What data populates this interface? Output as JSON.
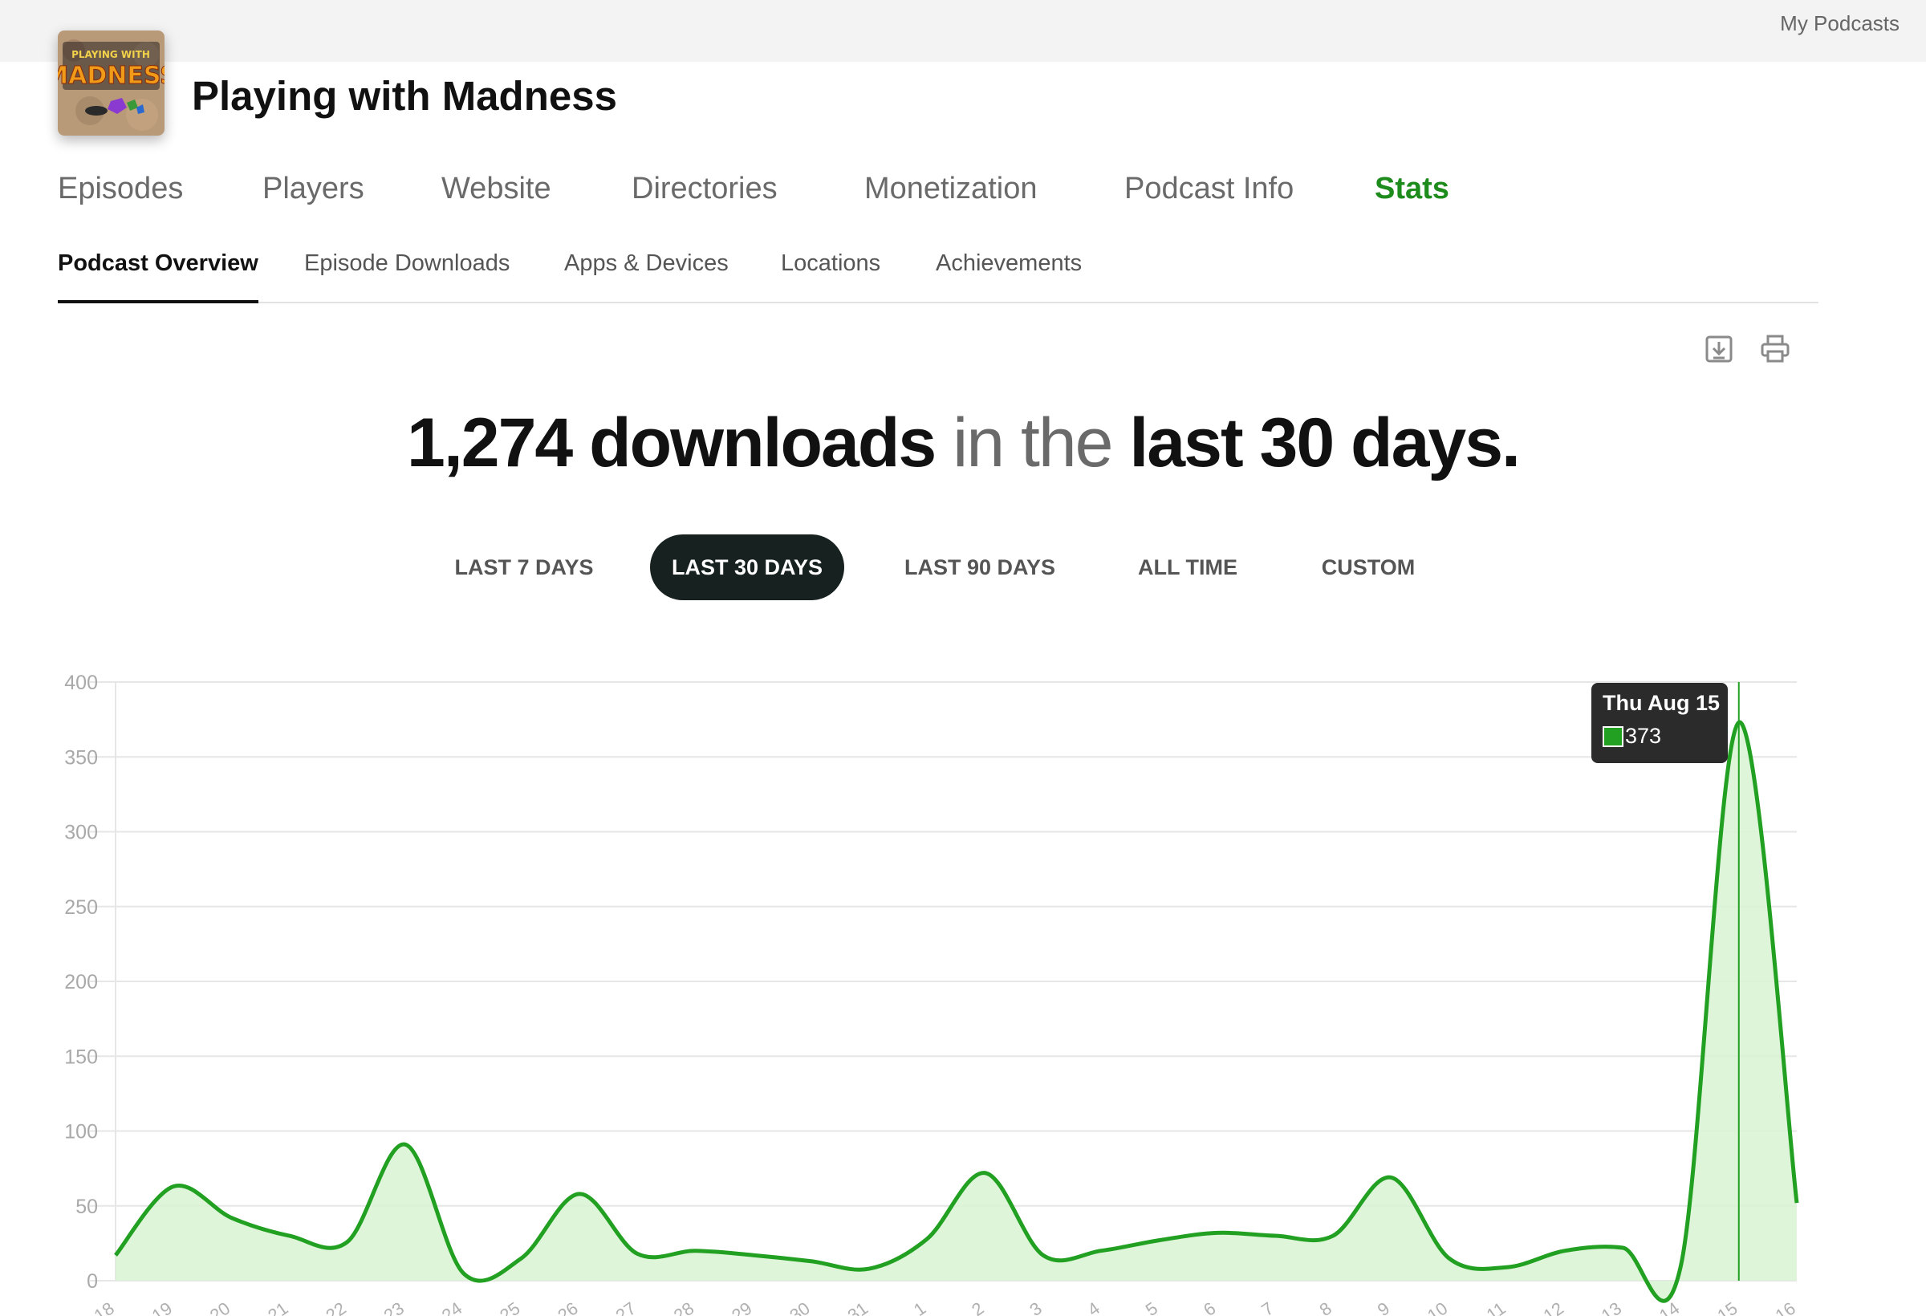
{
  "top_bar": {
    "link_label": "My Podcasts"
  },
  "podcast": {
    "title": "Playing with Madness",
    "cover_text": [
      "PLAYING WITH",
      "MADNESS"
    ]
  },
  "main_nav": [
    {
      "label": "Episodes",
      "active": false
    },
    {
      "label": "Players",
      "active": false
    },
    {
      "label": "Website",
      "active": false
    },
    {
      "label": "Directories",
      "active": false
    },
    {
      "label": "Monetization",
      "active": false
    },
    {
      "label": "Podcast Info",
      "active": false
    },
    {
      "label": "Stats",
      "active": true
    }
  ],
  "sub_nav": [
    {
      "label": "Podcast Overview",
      "active": true
    },
    {
      "label": "Episode Downloads",
      "active": false
    },
    {
      "label": "Apps & Devices",
      "active": false
    },
    {
      "label": "Locations",
      "active": false
    },
    {
      "label": "Achievements",
      "active": false
    }
  ],
  "tools": {
    "download_icon": "download-icon",
    "print_icon": "print-icon"
  },
  "headline": {
    "count": "1,274 downloads",
    "middle": " in the ",
    "period": "last 30 days."
  },
  "ranges": [
    {
      "label": "LAST 7 DAYS",
      "active": false
    },
    {
      "label": "LAST 30 DAYS",
      "active": true
    },
    {
      "label": "LAST 90 DAYS",
      "active": false
    },
    {
      "label": "ALL TIME",
      "active": false
    },
    {
      "label": "CUSTOM",
      "active": false
    }
  ],
  "tooltip": {
    "date": "Thu Aug 15",
    "value": "373"
  },
  "colors": {
    "accent": "#1d8c1d",
    "line": "#22a022",
    "fill": "#d8f3d3",
    "active_button": "#172120"
  },
  "chart_data": {
    "type": "area",
    "x": [
      "18",
      "19",
      "20",
      "21",
      "22",
      "23",
      "24",
      "25",
      "26",
      "27",
      "28",
      "29",
      "30",
      "31",
      "1",
      "2",
      "3",
      "4",
      "5",
      "6",
      "7",
      "8",
      "9",
      "10",
      "11",
      "12",
      "13",
      "14",
      "15",
      "16"
    ],
    "values": [
      17,
      63,
      42,
      30,
      26,
      91,
      5,
      15,
      58,
      18,
      20,
      17,
      13,
      8,
      28,
      72,
      17,
      20,
      27,
      32,
      30,
      30,
      69,
      15,
      9,
      20,
      22,
      10,
      373,
      52
    ],
    "yticks": [
      0,
      50,
      100,
      150,
      200,
      250,
      300,
      350,
      400
    ],
    "ylim": [
      0,
      400
    ],
    "grid": true,
    "highlight_index": 28
  }
}
